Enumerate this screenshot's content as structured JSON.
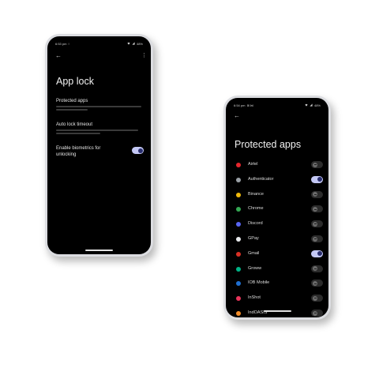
{
  "phone1": {
    "status": {
      "time": "6:53 pm",
      "extra": "!",
      "battery": "48%"
    },
    "title": "App lock",
    "settings": [
      {
        "title": "Protected apps"
      },
      {
        "title": "Auto lock timeout"
      },
      {
        "title": "Enable biometrics for unlocking",
        "line1": "Enable biometrics for",
        "line2": "unlocking",
        "toggle": "on"
      }
    ]
  },
  "phone2": {
    "status": {
      "time": "6:54 pm",
      "extra": "⊞ ⋈",
      "battery": "48%"
    },
    "title": "Protected apps",
    "apps": [
      {
        "name": "Airtel",
        "icon_color": "#e5262d",
        "enabled": false
      },
      {
        "name": "Authenticator",
        "icon_color": "#9aa0a6",
        "enabled": true
      },
      {
        "name": "Binance",
        "icon_color": "#f0b90b",
        "enabled": false
      },
      {
        "name": "Chrome",
        "icon_color": "#34a853",
        "enabled": false
      },
      {
        "name": "Discord",
        "icon_color": "#5865f2",
        "enabled": false
      },
      {
        "name": "GPay",
        "icon_color": "#e8eaed",
        "enabled": false
      },
      {
        "name": "Gmail",
        "icon_color": "#d93025",
        "enabled": true
      },
      {
        "name": "Groww",
        "icon_color": "#00b386",
        "enabled": false
      },
      {
        "name": "IOB Mobile",
        "icon_color": "#1f6fd0",
        "enabled": false
      },
      {
        "name": "InShot",
        "icon_color": "#e8345a",
        "enabled": false
      },
      {
        "name": "IndOASIS",
        "icon_color": "#f28c28",
        "enabled": false
      }
    ]
  },
  "colors": {
    "toggle_on_track": "#c4c8f5",
    "toggle_on_knob": "#2a2f6e",
    "screen_bg": "#000000"
  }
}
